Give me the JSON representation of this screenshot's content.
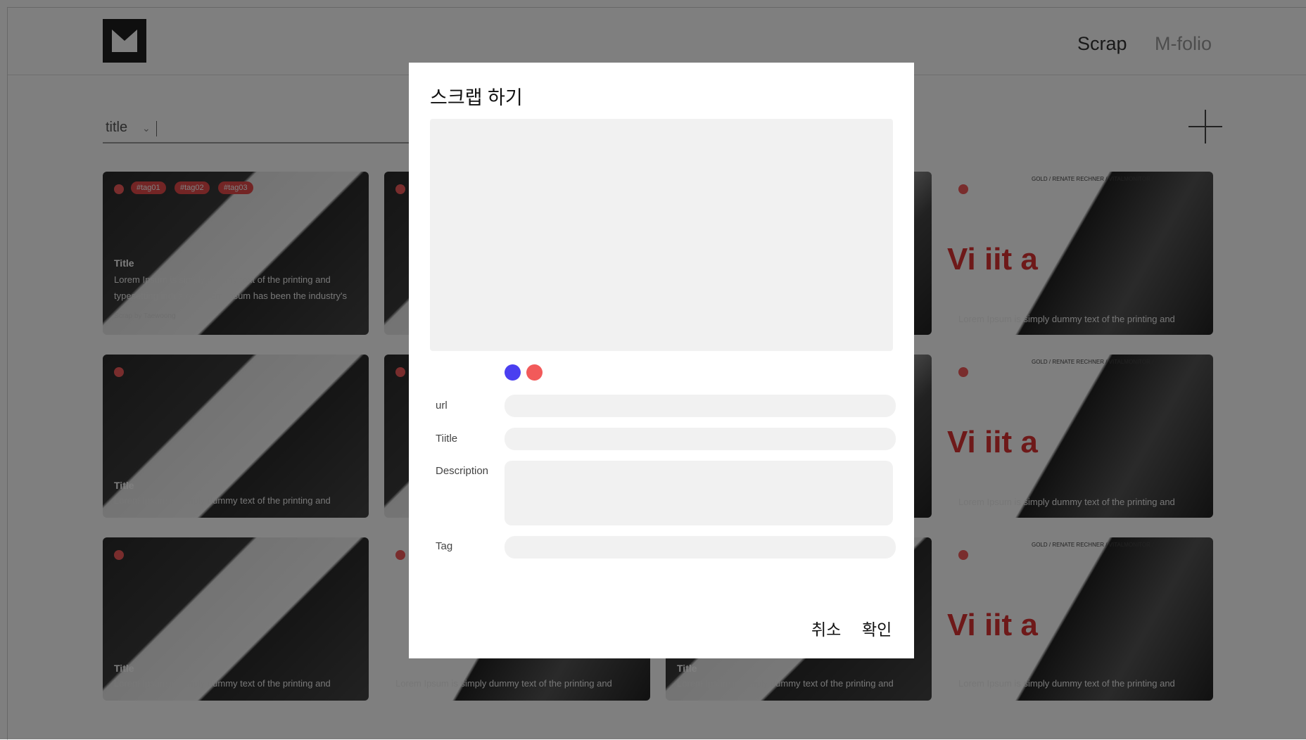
{
  "header": {
    "nav": [
      "Scrap",
      "M-folio"
    ]
  },
  "filter": {
    "label": "title",
    "chevron": "⌄"
  },
  "cards": {
    "tags": [
      "#tag01",
      "#tag02",
      "#tag03"
    ],
    "title": "Title",
    "desc_long": "Lorem Ipsum is simply dummy text of the printing and typesetting industry. Lorem Ipsum has been the industry's",
    "desc_short": "Lorem Ipsum is simply dummy text of the printing and",
    "meta": "Scrap by  Taewoong",
    "caption_small": "GOLD / RENATE RECHNER / VITALMONITOR /",
    "watch_text": "Vi  iit  a"
  },
  "modal": {
    "title": "스크랩 하기",
    "colors": [
      "#4a3ff0",
      "#f25a5a"
    ],
    "fields": {
      "url": "url",
      "title": "Tiitle",
      "description": "Description",
      "tag": "Tag"
    },
    "cancel": "취소",
    "confirm": "확인"
  }
}
